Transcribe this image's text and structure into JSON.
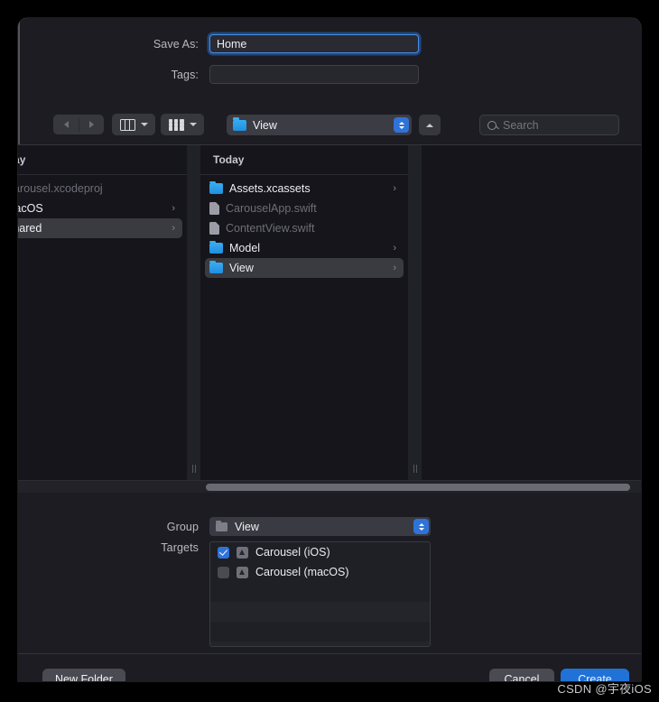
{
  "dialog": {
    "save_as_label": "Save As:",
    "save_as_value": "Home",
    "tags_label": "Tags:",
    "tags_value": "",
    "tags_placeholder": ""
  },
  "toolbar": {
    "back_icon": "chevron-left-icon",
    "forward_icon": "chevron-right-icon",
    "column_view_icon": "column-view-icon",
    "icon_view_icon": "grid-view-icon",
    "path_label": "View",
    "path_folder_icon": "folder-icon",
    "up_icon": "chevron-up-icon",
    "search_placeholder": "Search",
    "search_value": "",
    "search_icon": "search-icon"
  },
  "browser": {
    "columns": [
      {
        "name": "column-1",
        "group_header": "Today",
        "clipped": true,
        "rows": [
          {
            "label": "Carousel.xcodeproj",
            "icon": "none",
            "kind": "file",
            "dim": true,
            "disclosure": false,
            "selected": false
          },
          {
            "label": "macOS",
            "icon": "none",
            "kind": "folder",
            "dim": false,
            "disclosure": true,
            "selected": false
          },
          {
            "label": "Shared",
            "icon": "none",
            "kind": "folder",
            "dim": false,
            "disclosure": true,
            "selected": true
          }
        ]
      },
      {
        "name": "column-2",
        "group_header": "Today",
        "clipped": false,
        "rows": [
          {
            "label": "Assets.xcassets",
            "icon": "folder-icon",
            "kind": "folder",
            "dim": false,
            "disclosure": true,
            "selected": false
          },
          {
            "label": "CarouselApp.swift",
            "icon": "file-icon",
            "kind": "file",
            "dim": true,
            "disclosure": false,
            "selected": false
          },
          {
            "label": "ContentView.swift",
            "icon": "file-icon",
            "kind": "file",
            "dim": true,
            "disclosure": false,
            "selected": false
          },
          {
            "label": "Model",
            "icon": "folder-icon",
            "kind": "folder",
            "dim": false,
            "disclosure": true,
            "selected": false
          },
          {
            "label": "View",
            "icon": "folder-icon",
            "kind": "folder",
            "dim": false,
            "disclosure": true,
            "selected": true
          }
        ]
      },
      {
        "name": "column-3",
        "group_header": "",
        "clipped": false,
        "rows": []
      }
    ],
    "disclosure_glyph": "›"
  },
  "options": {
    "group_label": "Group",
    "group_value": "View",
    "group_folder_icon": "folder-icon",
    "targets_label": "Targets",
    "targets": [
      {
        "label": "Carousel (iOS)",
        "checked": true,
        "icon": "app-target-icon"
      },
      {
        "label": "Carousel (macOS)",
        "checked": false,
        "icon": "app-target-icon"
      }
    ]
  },
  "buttons": {
    "new_folder": "New Folder",
    "cancel": "Cancel",
    "create": "Create"
  },
  "watermark": "CSDN @宇夜iOS",
  "colors": {
    "accent_blue": "#2172d6",
    "folder_blue": "#2f9fe6",
    "sheet_bg": "#1c1c22",
    "browser_bg": "#15151b",
    "selected_row": "#3a3a41"
  }
}
